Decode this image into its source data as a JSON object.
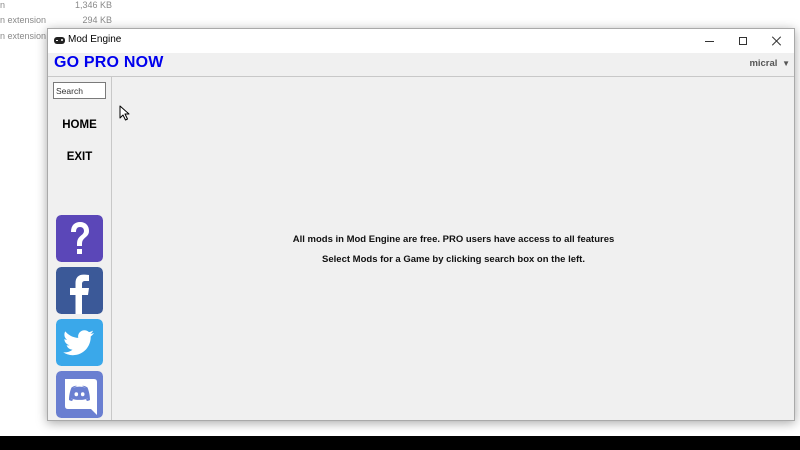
{
  "background_rows": [
    {
      "type": "n",
      "size": "1,346 KB"
    },
    {
      "type": "n extension",
      "size": "294 KB"
    },
    {
      "type": "n extension",
      "size": ""
    }
  ],
  "window": {
    "title": "Mod Engine"
  },
  "header": {
    "go_pro": "GO PRO NOW",
    "user": "micral",
    "user_caret": "▼"
  },
  "sidebar": {
    "search_placeholder": "Search",
    "nav": [
      {
        "label": "HOME"
      },
      {
        "label": "EXIT"
      }
    ],
    "social_icons": [
      "help-icon",
      "facebook-icon",
      "twitter-icon",
      "discord-icon"
    ]
  },
  "main": {
    "message_line1": "All mods in Mod Engine are free. PRO users have access to all features",
    "message_line2": "Select Mods for a Game by clicking search box on the left."
  },
  "colors": {
    "go_pro": "#0000ee",
    "help": "#5b47b8",
    "facebook": "#3b5998",
    "twitter": "#3aa8ea",
    "discord": "#6a7fd1"
  }
}
